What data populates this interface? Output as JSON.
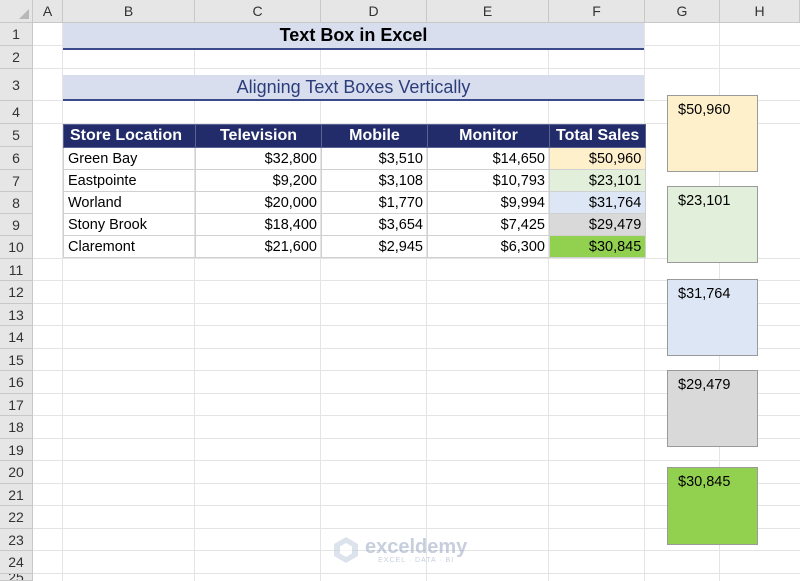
{
  "columns": [
    "A",
    "B",
    "C",
    "D",
    "E",
    "F",
    "G",
    "H"
  ],
  "rows": [
    "1",
    "2",
    "3",
    "4",
    "5",
    "6",
    "7",
    "8",
    "9",
    "10",
    "11",
    "12",
    "13",
    "14",
    "15",
    "16",
    "17",
    "18",
    "19",
    "20",
    "21",
    "22",
    "23",
    "24",
    "25"
  ],
  "title": "Text Box in Excel",
  "subtitle": "Aligning Text Boxes Vertically",
  "table": {
    "headers": [
      "Store Location",
      "Television",
      "Mobile",
      "Monitor",
      "Total Sales"
    ],
    "rows": [
      [
        "Green Bay",
        "$32,800",
        "$3,510",
        "$14,650",
        "$50,960"
      ],
      [
        "Eastpointe",
        "$9,200",
        "$3,108",
        "$10,793",
        "$23,101"
      ],
      [
        "Worland",
        "$20,000",
        "$1,770",
        "$9,994",
        "$31,764"
      ],
      [
        "Stony Brook",
        "$18,400",
        "$3,654",
        "$7,425",
        "$29,479"
      ],
      [
        "Claremont",
        "$21,600",
        "$2,945",
        "$6,300",
        "$30,845"
      ]
    ],
    "total_colors": [
      "#fff0cc",
      "#e2efda",
      "#dde6f5",
      "#d9d9d9",
      "#92d050"
    ]
  },
  "text_boxes": [
    {
      "value": "$50,960",
      "color": "#fff0cc"
    },
    {
      "value": "$23,101",
      "color": "#e2efda"
    },
    {
      "value": "$31,764",
      "color": "#dde6f5"
    },
    {
      "value": "$29,479",
      "color": "#d9d9d9"
    },
    {
      "value": "$30,845",
      "color": "#92d050"
    }
  ],
  "watermark": {
    "name": "exceldemy",
    "tagline": "EXCEL · DATA · BI"
  }
}
